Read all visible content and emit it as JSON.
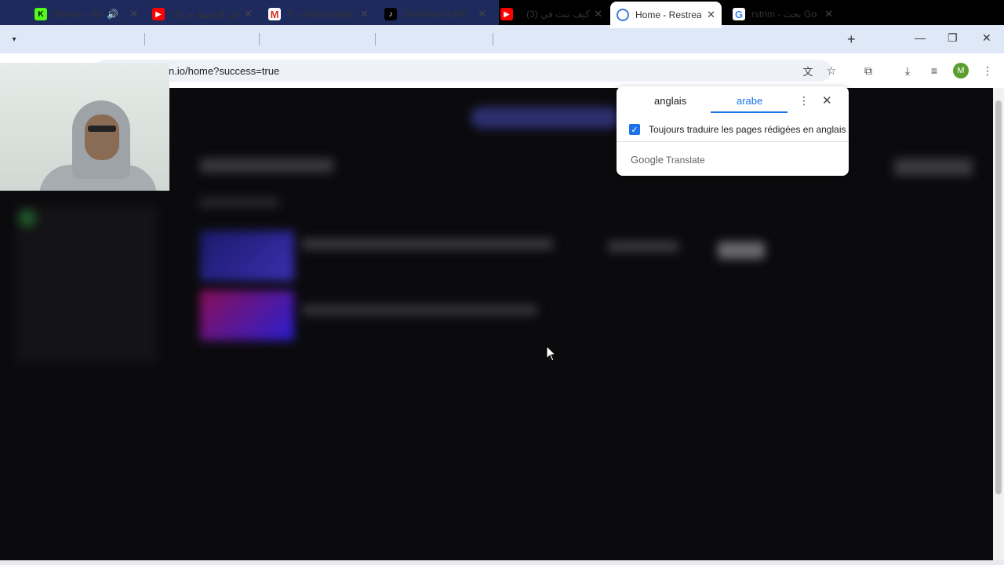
{
  "browser": {
    "tabs": [
      {
        "title": "Stream - Kick",
        "favicon": "kick-icon",
        "color": "#53fc18",
        "audio": true
      },
      {
        "title": "(3) عبد الباسط حـ",
        "favicon": "youtube-icon",
        "color": "#ff0000"
      },
      {
        "title": "S - mataouiabde",
        "favicon": "gmail-icon",
        "color": "#d93025"
      },
      {
        "title": "Download LIVE S",
        "favicon": "tiktok-icon",
        "color": "#000000"
      },
      {
        "title": "(3) كيف تبث في",
        "favicon": "youtube-icon",
        "color": "#ff0000"
      },
      {
        "title": "Home - Restream",
        "favicon": "restream-icon",
        "color": "#3a7bd5",
        "active": true
      },
      {
        "title": "rstrim - بحث Goo",
        "favicon": "google-icon",
        "color": "#4285f4"
      }
    ],
    "url": "n.io/home?success=true",
    "profile_initial": "M"
  },
  "translate_popup": {
    "source_lang": "anglais",
    "target_lang": "arabe",
    "always_translate_label": "Toujours traduire les pages rédigées en anglais",
    "always_translate_checked": true,
    "brand_google": "Google",
    "brand_translate": "Translate"
  },
  "colors": {
    "tabbar_bg": "#dfe8f7",
    "accent": "#1a73e8",
    "page_bg": "#0b0b0d"
  }
}
